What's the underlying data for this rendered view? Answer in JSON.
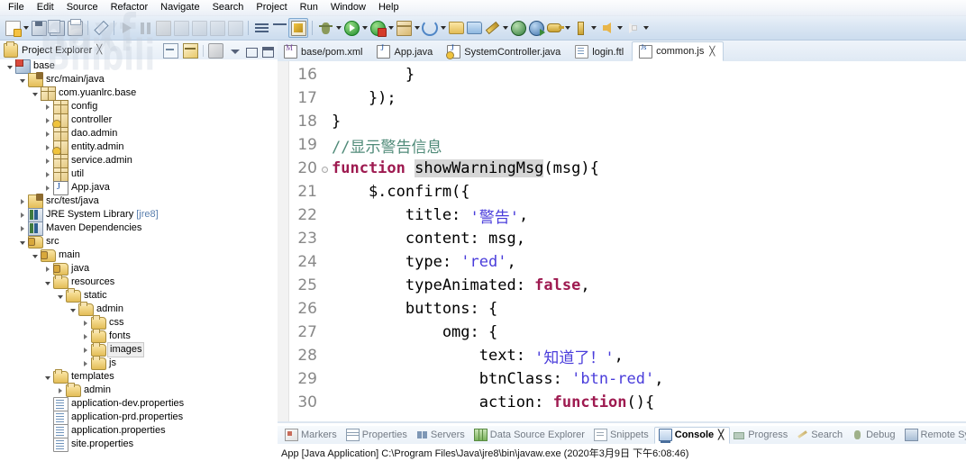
{
  "menubar": {
    "items": [
      "File",
      "Edit",
      "Source",
      "Refactor",
      "Navigate",
      "Search",
      "Project",
      "Run",
      "Window",
      "Help"
    ]
  },
  "watermark": {
    "line1": "naxf",
    "line2": "Bilibili"
  },
  "toolbar": {
    "buttons": [
      {
        "name": "new-wizard",
        "icon": "new-document-icon",
        "has_dropdown": true
      },
      {
        "name": "save",
        "icon": "save-icon",
        "has_dropdown": false
      },
      {
        "name": "save-all",
        "icon": "save-all-icon",
        "has_dropdown": false
      },
      {
        "name": "print",
        "icon": "print-icon",
        "has_dropdown": false
      },
      {
        "name": "toggle-mark-occurrences",
        "icon": "pen-icon",
        "has_dropdown": false
      },
      {
        "name": "resume",
        "icon": "resume-icon",
        "has_dropdown": false
      },
      {
        "name": "suspend",
        "icon": "pause-icon",
        "has_dropdown": false
      },
      {
        "name": "terminate",
        "icon": "stop-icon",
        "has_dropdown": false
      },
      {
        "name": "step-into",
        "icon": "step-into-icon",
        "has_dropdown": false
      },
      {
        "name": "step-over",
        "icon": "step-over-icon",
        "has_dropdown": false
      },
      {
        "name": "step-return",
        "icon": "step-return-icon",
        "has_dropdown": false
      },
      {
        "name": "skip-breakpoints",
        "icon": "skip-breakpoints-icon",
        "has_dropdown": false
      },
      {
        "name": "open-type",
        "icon": "open-type-icon",
        "has_dropdown": false
      },
      {
        "name": "search",
        "icon": "search-filter-icon",
        "has_dropdown": false
      },
      {
        "name": "toggle-java-editor",
        "icon": "brush-icon",
        "has_dropdown": false,
        "pressed": true
      },
      {
        "name": "debug",
        "icon": "debug-bug-icon",
        "has_dropdown": true
      },
      {
        "name": "run",
        "icon": "run-play-icon",
        "has_dropdown": true
      },
      {
        "name": "run-external-tools",
        "icon": "run-lock-icon",
        "has_dropdown": true
      },
      {
        "name": "new-java-package",
        "icon": "package-icon",
        "has_dropdown": true
      },
      {
        "name": "refresh-cycle",
        "icon": "cycle-icon",
        "has_dropdown": true
      },
      {
        "name": "open-resource",
        "icon": "folder-open-icon",
        "has_dropdown": false
      },
      {
        "name": "new-folder",
        "icon": "folder-blue-icon",
        "has_dropdown": false
      },
      {
        "name": "quick-fix",
        "icon": "wand-icon",
        "has_dropdown": true
      },
      {
        "name": "open-web-browser",
        "icon": "globe-icon",
        "has_dropdown": false
      },
      {
        "name": "publish",
        "icon": "globe-publish-icon",
        "has_dropdown": false
      },
      {
        "name": "key-binding",
        "icon": "key-icon",
        "has_dropdown": true
      },
      {
        "name": "pin-editor",
        "icon": "pin-icon",
        "has_dropdown": true
      },
      {
        "name": "back",
        "icon": "back-arrow-icon",
        "has_dropdown": true
      },
      {
        "name": "forward",
        "icon": "forward-arrow-icon",
        "has_dropdown": true
      }
    ]
  },
  "project_explorer": {
    "title": "Project Explorer",
    "close_glyph": "╳",
    "tools": [
      {
        "name": "collapse-all-button",
        "icon": "collapse-all-icon"
      },
      {
        "name": "link-with-editor-button",
        "icon": "link-editor-icon"
      },
      {
        "name": "view-filter-button",
        "icon": "view-filter-icon"
      },
      {
        "name": "view-menu-button",
        "icon": "chevron-down-icon"
      },
      {
        "name": "minimize-button",
        "icon": "minimize-icon"
      },
      {
        "name": "maximize-button",
        "icon": "maximize-icon"
      }
    ],
    "tree": [
      {
        "label": "base",
        "indent": 0,
        "twist": "expanded",
        "icon": "project-icon",
        "suffix": ""
      },
      {
        "label": "src/main/java",
        "indent": 1,
        "twist": "expanded",
        "icon": "source-folder-icon",
        "suffix": ""
      },
      {
        "label": "com.yuanlrc.base",
        "indent": 2,
        "twist": "expanded",
        "icon": "package-icon",
        "suffix": ""
      },
      {
        "label": "config",
        "indent": 3,
        "twist": "collapsed",
        "icon": "package-icon",
        "suffix": ""
      },
      {
        "label": "controller",
        "indent": 3,
        "twist": "collapsed",
        "icon": "package-warning-icon",
        "suffix": ""
      },
      {
        "label": "dao.admin",
        "indent": 3,
        "twist": "collapsed",
        "icon": "package-icon",
        "suffix": ""
      },
      {
        "label": "entity.admin",
        "indent": 3,
        "twist": "collapsed",
        "icon": "package-warning-icon",
        "suffix": ""
      },
      {
        "label": "service.admin",
        "indent": 3,
        "twist": "collapsed",
        "icon": "package-icon",
        "suffix": ""
      },
      {
        "label": "util",
        "indent": 3,
        "twist": "collapsed",
        "icon": "package-icon",
        "suffix": ""
      },
      {
        "label": "App.java",
        "indent": 3,
        "twist": "collapsed",
        "icon": "java-file-icon",
        "suffix": ""
      },
      {
        "label": "src/test/java",
        "indent": 1,
        "twist": "collapsed",
        "icon": "source-folder-icon",
        "suffix": ""
      },
      {
        "label": "JRE System Library",
        "indent": 1,
        "twist": "collapsed",
        "icon": "library-icon",
        "suffix": "[jre8]"
      },
      {
        "label": "Maven Dependencies",
        "indent": 1,
        "twist": "collapsed",
        "icon": "library-icon",
        "suffix": ""
      },
      {
        "label": "src",
        "indent": 1,
        "twist": "expanded",
        "icon": "source-root-icon",
        "suffix": ""
      },
      {
        "label": "main",
        "indent": 2,
        "twist": "expanded",
        "icon": "source-root-icon",
        "suffix": ""
      },
      {
        "label": "java",
        "indent": 3,
        "twist": "collapsed",
        "icon": "source-root-icon",
        "suffix": ""
      },
      {
        "label": "resources",
        "indent": 3,
        "twist": "expanded",
        "icon": "folder-icon",
        "suffix": ""
      },
      {
        "label": "static",
        "indent": 4,
        "twist": "expanded",
        "icon": "folder-icon",
        "suffix": ""
      },
      {
        "label": "admin",
        "indent": 5,
        "twist": "expanded",
        "icon": "folder-icon",
        "suffix": ""
      },
      {
        "label": "css",
        "indent": 6,
        "twist": "collapsed",
        "icon": "folder-icon",
        "suffix": ""
      },
      {
        "label": "fonts",
        "indent": 6,
        "twist": "collapsed",
        "icon": "folder-icon",
        "suffix": ""
      },
      {
        "label": "images",
        "indent": 6,
        "twist": "collapsed",
        "icon": "folder-icon",
        "suffix": "",
        "selected": true
      },
      {
        "label": "js",
        "indent": 6,
        "twist": "collapsed",
        "icon": "folder-icon",
        "suffix": ""
      },
      {
        "label": "templates",
        "indent": 3,
        "twist": "expanded",
        "icon": "folder-icon",
        "suffix": ""
      },
      {
        "label": "admin",
        "indent": 4,
        "twist": "collapsed",
        "icon": "folder-icon",
        "suffix": ""
      },
      {
        "label": "application-dev.properties",
        "indent": 3,
        "twist": "none",
        "icon": "properties-file-icon",
        "suffix": ""
      },
      {
        "label": "application-prd.properties",
        "indent": 3,
        "twist": "none",
        "icon": "properties-file-icon",
        "suffix": ""
      },
      {
        "label": "application.properties",
        "indent": 3,
        "twist": "none",
        "icon": "properties-file-icon",
        "suffix": ""
      },
      {
        "label": "site.properties",
        "indent": 3,
        "twist": "none",
        "icon": "properties-file-icon",
        "suffix": ""
      }
    ]
  },
  "editor": {
    "tabs": [
      {
        "label": "base/pom.xml",
        "icon": "xml-file-icon",
        "active": false,
        "close": ""
      },
      {
        "label": "App.java",
        "icon": "java-file-icon",
        "active": false,
        "close": ""
      },
      {
        "label": "SystemController.java",
        "icon": "java-warning-file-icon",
        "active": false,
        "close": ""
      },
      {
        "label": "login.ftl",
        "icon": "ftl-file-icon",
        "active": false,
        "close": ""
      },
      {
        "label": "common.js",
        "icon": "js-file-icon",
        "active": true,
        "close": "╳"
      }
    ],
    "lines": [
      {
        "num": "16",
        "fold": false,
        "parts": [
          {
            "t": "        }",
            "c": "plain"
          }
        ]
      },
      {
        "num": "17",
        "fold": false,
        "parts": [
          {
            "t": "    });",
            "c": "plain"
          }
        ]
      },
      {
        "num": "18",
        "fold": false,
        "parts": [
          {
            "t": "}",
            "c": "plain"
          }
        ]
      },
      {
        "num": "19",
        "fold": false,
        "parts": [
          {
            "t": "//显示警告信息",
            "c": "comment"
          }
        ]
      },
      {
        "num": "20",
        "fold": true,
        "parts": [
          {
            "t": "function ",
            "c": "keyword"
          },
          {
            "t": "showWarningMsg",
            "c": "highlight"
          },
          {
            "t": "(msg){",
            "c": "plain"
          }
        ]
      },
      {
        "num": "21",
        "fold": false,
        "parts": [
          {
            "t": "    $.confirm({",
            "c": "plain"
          }
        ]
      },
      {
        "num": "22",
        "fold": false,
        "parts": [
          {
            "t": "        title: ",
            "c": "plain"
          },
          {
            "t": "'警告'",
            "c": "string"
          },
          {
            "t": ",",
            "c": "plain"
          }
        ]
      },
      {
        "num": "23",
        "fold": false,
        "parts": [
          {
            "t": "        content: msg,",
            "c": "plain"
          }
        ]
      },
      {
        "num": "24",
        "fold": false,
        "parts": [
          {
            "t": "        type: ",
            "c": "plain"
          },
          {
            "t": "'red'",
            "c": "string"
          },
          {
            "t": ",",
            "c": "plain"
          }
        ]
      },
      {
        "num": "25",
        "fold": false,
        "parts": [
          {
            "t": "        typeAnimated: ",
            "c": "plain"
          },
          {
            "t": "false",
            "c": "keyword"
          },
          {
            "t": ",",
            "c": "plain"
          }
        ]
      },
      {
        "num": "26",
        "fold": false,
        "parts": [
          {
            "t": "        buttons: {",
            "c": "plain"
          }
        ]
      },
      {
        "num": "27",
        "fold": false,
        "parts": [
          {
            "t": "            omg: {",
            "c": "plain"
          }
        ]
      },
      {
        "num": "28",
        "fold": false,
        "parts": [
          {
            "t": "                text: ",
            "c": "plain"
          },
          {
            "t": "'知道了！'",
            "c": "string"
          },
          {
            "t": ",",
            "c": "plain"
          }
        ]
      },
      {
        "num": "29",
        "fold": false,
        "parts": [
          {
            "t": "                btnClass: ",
            "c": "plain"
          },
          {
            "t": "'btn-red'",
            "c": "string"
          },
          {
            "t": ",",
            "c": "plain"
          }
        ]
      },
      {
        "num": "30",
        "fold": false,
        "parts": [
          {
            "t": "                action: ",
            "c": "plain"
          },
          {
            "t": "function",
            "c": "keyword"
          },
          {
            "t": "(){",
            "c": "plain"
          }
        ]
      }
    ]
  },
  "bottom_panel": {
    "tabs": [
      {
        "label": "Markers",
        "icon": "markers-icon",
        "active": false,
        "close": ""
      },
      {
        "label": "Properties",
        "icon": "properties-icon",
        "active": false,
        "close": ""
      },
      {
        "label": "Servers",
        "icon": "servers-icon",
        "active": false,
        "close": ""
      },
      {
        "label": "Data Source Explorer",
        "icon": "data-source-icon",
        "active": false,
        "close": ""
      },
      {
        "label": "Snippets",
        "icon": "snippets-icon",
        "active": false,
        "close": ""
      },
      {
        "label": "Console",
        "icon": "console-icon",
        "active": true,
        "close": "╳"
      },
      {
        "label": "Progress",
        "icon": "progress-icon",
        "active": false,
        "close": ""
      },
      {
        "label": "Search",
        "icon": "search-icon",
        "active": false,
        "close": ""
      },
      {
        "label": "Debug",
        "icon": "debug-icon",
        "active": false,
        "close": ""
      },
      {
        "label": "Remote Systems",
        "icon": "remote-systems-icon",
        "active": false,
        "close": ""
      }
    ],
    "console_status": "App [Java Application] C:\\Program Files\\Java\\jre8\\bin\\javaw.exe (2020年3月9日 下午6:08:46)"
  },
  "colors": {
    "keyword": "#9e1a50",
    "string": "#4a3ddb",
    "comment": "#4f8a78",
    "highlight_bg": "#d6d6d6",
    "line_number": "#888888",
    "chrome": "#dae6f3"
  }
}
